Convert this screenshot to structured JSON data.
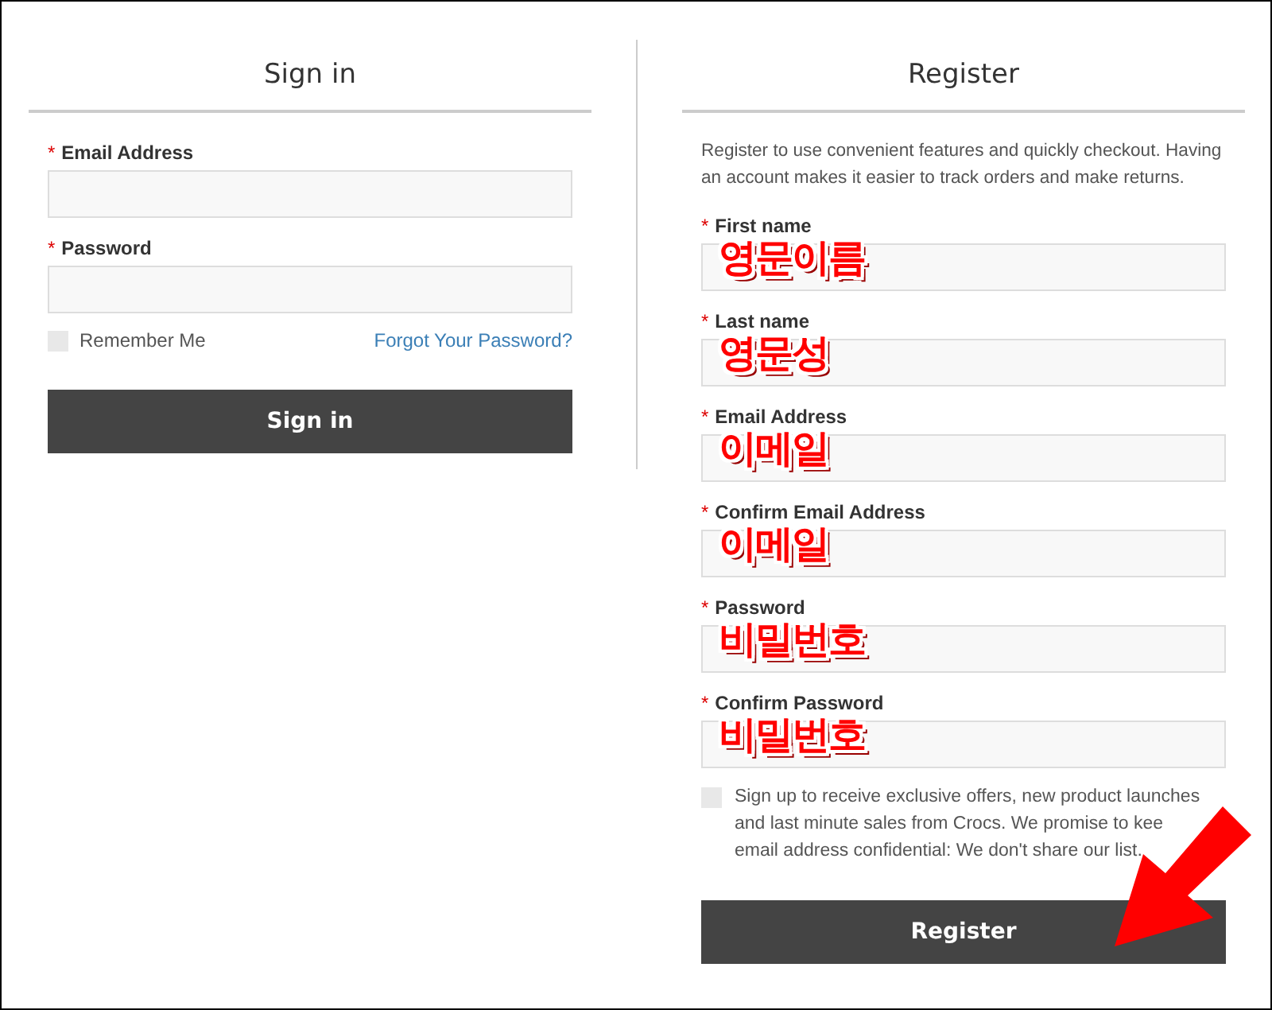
{
  "sign_in": {
    "title": "Sign in",
    "fields": [
      {
        "label": "Email Address",
        "required_mark": "*"
      },
      {
        "label": "Password",
        "required_mark": "*"
      }
    ],
    "remember_me": {
      "label": "Remember Me",
      "checked": false
    },
    "forgot_link": "Forgot Your Password?",
    "button": "Sign in"
  },
  "register": {
    "title": "Register",
    "description": "Register to use convenient features and quickly checkout. Having an account makes it easier to track orders and make returns.",
    "fields": [
      {
        "label": "First name",
        "required_mark": "*",
        "annotation": "영문이름"
      },
      {
        "label": "Last name",
        "required_mark": "*",
        "annotation": "영문성"
      },
      {
        "label": "Email Address",
        "required_mark": "*",
        "annotation": "이메일"
      },
      {
        "label": "Confirm Email Address",
        "required_mark": "*",
        "annotation": "이메일"
      },
      {
        "label": "Password",
        "required_mark": "*",
        "annotation": "비밀번호"
      },
      {
        "label": "Confirm Password",
        "required_mark": "*",
        "annotation": "비밀번호"
      }
    ],
    "newsletter": {
      "label_lines": [
        "Sign up to receive exclusive offers, new product launches",
        "and last minute sales from Crocs. We promise to kee",
        "email address confidential: We don't share our list."
      ],
      "checked": false
    },
    "button": "Register"
  }
}
